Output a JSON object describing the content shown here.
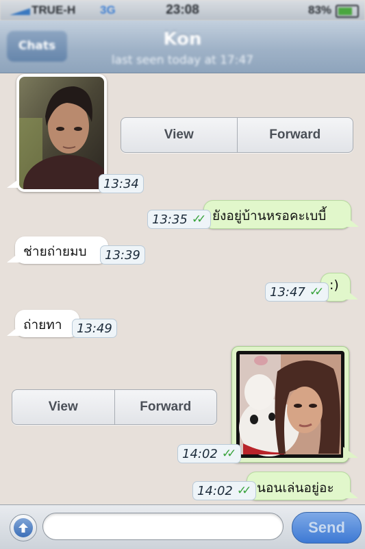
{
  "status_bar": {
    "carrier": "TRUE-H",
    "network": "3G",
    "time": "23:08",
    "battery": "83%"
  },
  "nav": {
    "back_label": "Chats",
    "title": "Kon",
    "subtitle": "last seen today at 17:47"
  },
  "photo_actions": {
    "view_label": "View",
    "forward_label": "Forward"
  },
  "messages": [
    {
      "id": "m1",
      "direction": "incoming",
      "kind": "photo",
      "time": "13:34"
    },
    {
      "id": "m2",
      "direction": "outgoing",
      "kind": "text",
      "text": "ยังอยู่บ้านหรอคะเบบี้",
      "time": "13:35"
    },
    {
      "id": "m3",
      "direction": "incoming",
      "kind": "text",
      "text": "ช่ายถ่ายมบ",
      "time": "13:39"
    },
    {
      "id": "m4",
      "direction": "outgoing",
      "kind": "text",
      "text": ":)",
      "time": "13:47"
    },
    {
      "id": "m5",
      "direction": "incoming",
      "kind": "text",
      "text": "ถ่ายทา",
      "time": "13:49"
    },
    {
      "id": "m6",
      "direction": "outgoing",
      "kind": "photo",
      "time": "14:02"
    },
    {
      "id": "m7",
      "direction": "outgoing",
      "kind": "text",
      "text": "นอนเล่นอยู่อะ",
      "time": "14:02"
    }
  ],
  "input_bar": {
    "placeholder": "",
    "send_label": "Send"
  },
  "colors": {
    "chat_background": "#e7e0da",
    "outgoing_bubble": "#e1f7cb",
    "incoming_bubble": "#ffffff",
    "read_check": "#39a33c",
    "nav_bar": "#9fb2c7"
  }
}
